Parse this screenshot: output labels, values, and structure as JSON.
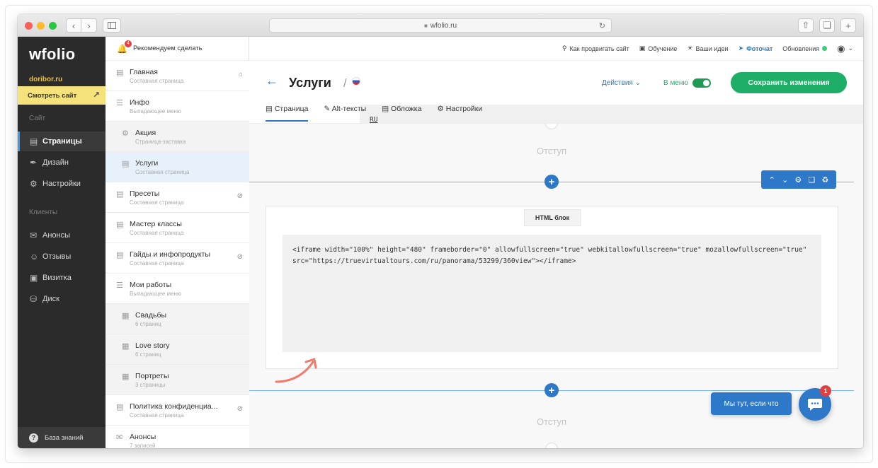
{
  "browser": {
    "url": "wfolio.ru",
    "nav": {
      "back": "‹",
      "forward": "›"
    }
  },
  "leftnav": {
    "logo": "wfolio",
    "domain": "doribor.ru",
    "view_site": "Смотреть сайт",
    "section_site": "Сайт",
    "section_clients": "Клиенты",
    "items": [
      {
        "label": "Страницы",
        "icon": "page-icon"
      },
      {
        "label": "Дизайн",
        "icon": "brush-icon"
      },
      {
        "label": "Настройки",
        "icon": "gear-icon"
      },
      {
        "label": "Анонсы",
        "icon": "megaphone-icon"
      },
      {
        "label": "Отзывы",
        "icon": "chat-icon"
      },
      {
        "label": "Визитка",
        "icon": "card-icon"
      },
      {
        "label": "Диск",
        "icon": "disk-icon"
      }
    ],
    "knowledge_base": "База знаний"
  },
  "pages": {
    "recommend": "Рекомендуем сделать",
    "recommend_badge": "4",
    "items": [
      {
        "title": "Главная",
        "sub": "Составная страница"
      },
      {
        "title": "Инфо",
        "sub": "Выпадающее меню"
      },
      {
        "title": "Акция",
        "sub": "Страница-заставка"
      },
      {
        "title": "Услуги",
        "sub": "Составная страница"
      },
      {
        "title": "Пресеты",
        "sub": "Составная страница"
      },
      {
        "title": "Мастер классы",
        "sub": "Составная страница"
      },
      {
        "title": "Гайды и инфопродукты",
        "sub": "Составная страница"
      },
      {
        "title": "Мои работы",
        "sub": "Выпадающее меню"
      },
      {
        "title": "Свадьбы",
        "sub": "6 страниц"
      },
      {
        "title": "Love story",
        "sub": "6 страниц"
      },
      {
        "title": "Портреты",
        "sub": "3 страницы"
      },
      {
        "title": "Политика конфиденциа...",
        "sub": "Составная страница"
      },
      {
        "title": "Анонсы",
        "sub": "7 записей"
      }
    ]
  },
  "topbar": {
    "promote": "Как продвигать сайт",
    "learning": "Обучение",
    "ideas": "Ваши идеи",
    "fotochat": "Фоточат",
    "updates": "Обновления"
  },
  "header": {
    "title": "Услуги",
    "lang": "RU",
    "actions": "Действия",
    "in_menu": "В меню",
    "save": "Сохранить изменения"
  },
  "tabs": [
    "Страница",
    "Alt-тексты",
    "Обложка",
    "Настройки"
  ],
  "canvas": {
    "spacer_label": "Отступ",
    "html_block_label": "HTML блок",
    "code": "<iframe width=\"100%\" height=\"480\" frameborder=\"0\" allowfullscreen=\"true\" webkitallowfullscreen=\"true\" mozallowfullscreen=\"true\" src=\"https://truevirtualtours.com/ru/panorama/53299/360view\"></iframe>"
  },
  "chat": {
    "label": "Мы тут, если что",
    "badge": "1"
  },
  "colors": {
    "accent": "#2d78c8",
    "save_green": "#1fae67",
    "nav_bg": "#2b2b2b",
    "view_site_bg": "#f6e27a"
  }
}
